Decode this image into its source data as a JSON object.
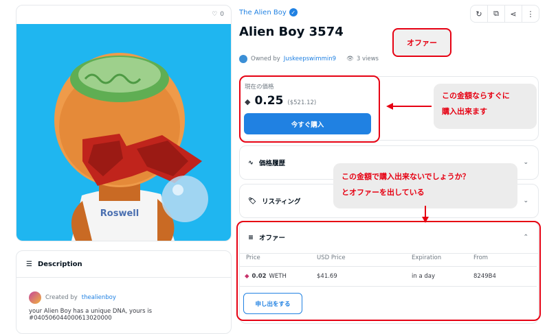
{
  "art": {
    "likes": "0",
    "character_text": "Roswell"
  },
  "description": {
    "heading": "Description",
    "created_prefix": "Created by",
    "created_by": "thealienboy",
    "line1": "your Alien Boy has a unique DNA, yours is",
    "line2": "#040506044000613020000"
  },
  "header": {
    "collection": "The Alien Boy",
    "title": "Alien Boy 3574",
    "owned_prefix": "Owned by",
    "owner": "Juskeepswimmin9",
    "views": "3 views"
  },
  "toolbar": {
    "icons": [
      "refresh-icon",
      "external-link-icon",
      "share-icon",
      "more-icon"
    ]
  },
  "price": {
    "label": "現在の価格",
    "value": "0.25",
    "usd": "($521.12)",
    "buy_label": "今すぐ購入"
  },
  "sections": {
    "price_history": "価格履歴",
    "listings": "リスティング",
    "offers": "オファー"
  },
  "offers_table": {
    "headers": [
      "Price",
      "USD Price",
      "Expiration",
      "From"
    ],
    "rows": [
      {
        "price": "0.02",
        "token": "WETH",
        "usd": "$41.69",
        "expiration": "in a day",
        "from": "8249B4"
      }
    ],
    "make_offer_label": "申し出をする"
  },
  "annotations": {
    "offer_tag": "オファー",
    "buy_now_note_1": "この金額ならすぐに",
    "buy_now_note_2": "購入出来ます",
    "offer_note_1": "この金額で購入出来ないでしょうか？",
    "offer_note_2": "とオファーを出している"
  },
  "colors": {
    "accent": "#2081e2",
    "annotation_red": "#e60012",
    "art_bg": "#1fb6f0"
  }
}
